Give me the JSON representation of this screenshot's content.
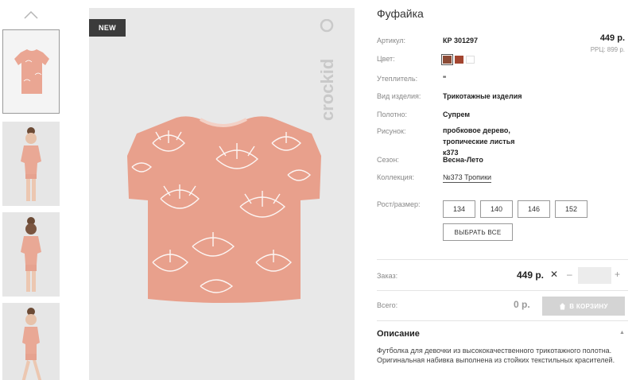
{
  "product": {
    "badge": "NEW",
    "brand": "crockid",
    "title": "Фуфайка",
    "price": "449 р.",
    "rrp": "РРЦ: 899 р."
  },
  "attributes": [
    {
      "label": "Артикул:",
      "value": "КР 301297"
    },
    {
      "label": "Цвет:",
      "value": ""
    },
    {
      "label": "Утеплитель:",
      "value": "\""
    },
    {
      "label": "Вид изделия:",
      "value": "Трикотажные изделия"
    },
    {
      "label": "Полотно:",
      "value": "Супрем"
    },
    {
      "label": "Рисунок:",
      "value": "пробковое дерево, тропические листья к373"
    },
    {
      "label": "Сезон:",
      "value": "Весна-Лето"
    },
    {
      "label": "Коллекция:",
      "value": "№373 Тропики"
    }
  ],
  "colors": [
    "#8b4a35",
    "#a34530",
    "#ffffff"
  ],
  "sizes": {
    "label": "Рост/размер:",
    "options": [
      "134",
      "140",
      "146",
      "152"
    ],
    "select_all": "ВЫБРАТЬ ВСЕ"
  },
  "order": {
    "label": "Заказ:",
    "price": "449 р.",
    "times": "✕",
    "minus": "–",
    "plus": "+",
    "quantity": ""
  },
  "total": {
    "label": "Всего:",
    "value": "0 р.",
    "cart_button": "В КОРЗИНУ"
  },
  "description": {
    "title": "Описание",
    "caret": "▲",
    "text": "Футболка для девочки из высококачественного трикотажного полотна. Оригинальная набивка выполнена из стойких текстильных красителей."
  },
  "icons": {
    "thumbnails_up": "chevron-up-icon",
    "cart": "cart-icon"
  }
}
